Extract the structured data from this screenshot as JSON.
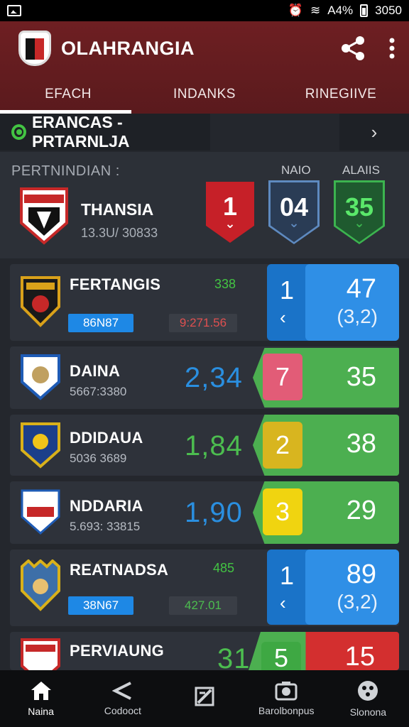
{
  "status": {
    "left_icon": "gallery-icon",
    "battery_text": "A4%",
    "time": "3050"
  },
  "appbar": {
    "title": "OLAHRANGIA",
    "share_icon": "share-icon",
    "more_icon": "more-vert-icon"
  },
  "tabs": [
    {
      "label": "EFACH",
      "active": true
    },
    {
      "label": "INDANKS",
      "active": false
    },
    {
      "label": "RINEGIIVE",
      "active": false
    }
  ],
  "filter": {
    "label": "ERANCAS - PRTARNLJA",
    "chevron": "›"
  },
  "featured": {
    "section_label": "PERTNINDIAN :",
    "col_labels": [
      "NAIO",
      "ALAIIS"
    ],
    "team_name": "THANSIA",
    "team_sub": "13.3U/ 30833",
    "scores": [
      "1",
      "04",
      "35"
    ]
  },
  "matches": [
    {
      "name": "FERTANGIS",
      "pill": "86N87",
      "small_val": "338",
      "dark_pill": "9:271.56",
      "rank": "1",
      "points": "47",
      "sub": "(3,2)",
      "style": "blue"
    },
    {
      "name": "DAINA",
      "sub_text": "5667:3380",
      "big_val": "2,34",
      "rank": "7",
      "points": "35",
      "style": "green",
      "tab_color": "#e25c77",
      "big_color": "#2a8fe0"
    },
    {
      "name": "DDIDAUA",
      "sub_text": "5036 3689",
      "big_val": "1,84",
      "rank": "2",
      "points": "38",
      "style": "green",
      "tab_color": "#d8b51f",
      "big_color": "#4cbd4f"
    },
    {
      "name": "NDDARIA",
      "sub_text": "5.693: 33815",
      "big_val": "1,90",
      "rank": "3",
      "points": "29",
      "style": "green",
      "tab_color": "#f0d410",
      "big_color": "#2a8fe0"
    },
    {
      "name": "REATNADSA",
      "pill": "38N67",
      "small_val": "485",
      "dark_pill": "427.01",
      "rank": "1",
      "points": "89",
      "sub": "(3,2)",
      "style": "blue"
    },
    {
      "name": "PERVIAUNG",
      "big_val": "31",
      "rank": "5",
      "points": "15",
      "style": "green-red"
    }
  ],
  "nav": [
    {
      "label": "Naina",
      "icon": "home-icon"
    },
    {
      "label": "Codooct",
      "icon": "share-icon"
    },
    {
      "label": "",
      "icon": "strategy-icon"
    },
    {
      "label": "Barolbonpus",
      "icon": "camera-icon"
    },
    {
      "label": "Slonona",
      "icon": "ball-icon"
    }
  ],
  "colors": {
    "appbar": "#6e1f22",
    "background": "#24272d",
    "card": "#2e323a",
    "blue": "#1a73c8",
    "green": "#4caf50",
    "red": "#c62028"
  }
}
